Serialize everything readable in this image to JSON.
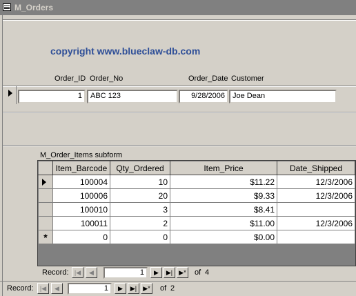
{
  "window": {
    "title": "M_Orders"
  },
  "main_form": {
    "copyright": "copyright www.blueclaw-db.com",
    "labels": {
      "order_id": "Order_ID",
      "order_no": "Order_No",
      "order_date": "Order_Date",
      "customer": "Customer"
    },
    "record": {
      "order_id": "1",
      "order_no": "ABC 123",
      "order_date": "9/28/2006",
      "customer": "Joe Dean"
    }
  },
  "subform": {
    "label": "M_Order_Items subform",
    "columns": [
      "Item_Barcode",
      "Qty_Ordered",
      "Item_Price",
      "Date_Shipped"
    ],
    "rows": [
      {
        "barcode": "100004",
        "qty": "10",
        "price": "$11.22",
        "date": "12/3/2006",
        "current": true
      },
      {
        "barcode": "100006",
        "qty": "20",
        "price": "$9.33",
        "date": "12/3/2006"
      },
      {
        "barcode": "100010",
        "qty": "3",
        "price": "$8.41",
        "date": ""
      },
      {
        "barcode": "100011",
        "qty": "2",
        "price": "$11.00",
        "date": "12/3/2006"
      }
    ],
    "new_row": {
      "marker": "*",
      "barcode": "0",
      "qty": "0",
      "price": "$0.00",
      "date": ""
    },
    "nav": {
      "label": "Record:",
      "current": "1",
      "of_label": "of",
      "total": "4"
    }
  },
  "main_nav": {
    "label": "Record:",
    "current": "1",
    "of_label": "of",
    "total": "2"
  },
  "nav_buttons": {
    "first": "|◀",
    "prev": "◀",
    "next": "▶",
    "last": "▶|",
    "new": "▶*"
  }
}
